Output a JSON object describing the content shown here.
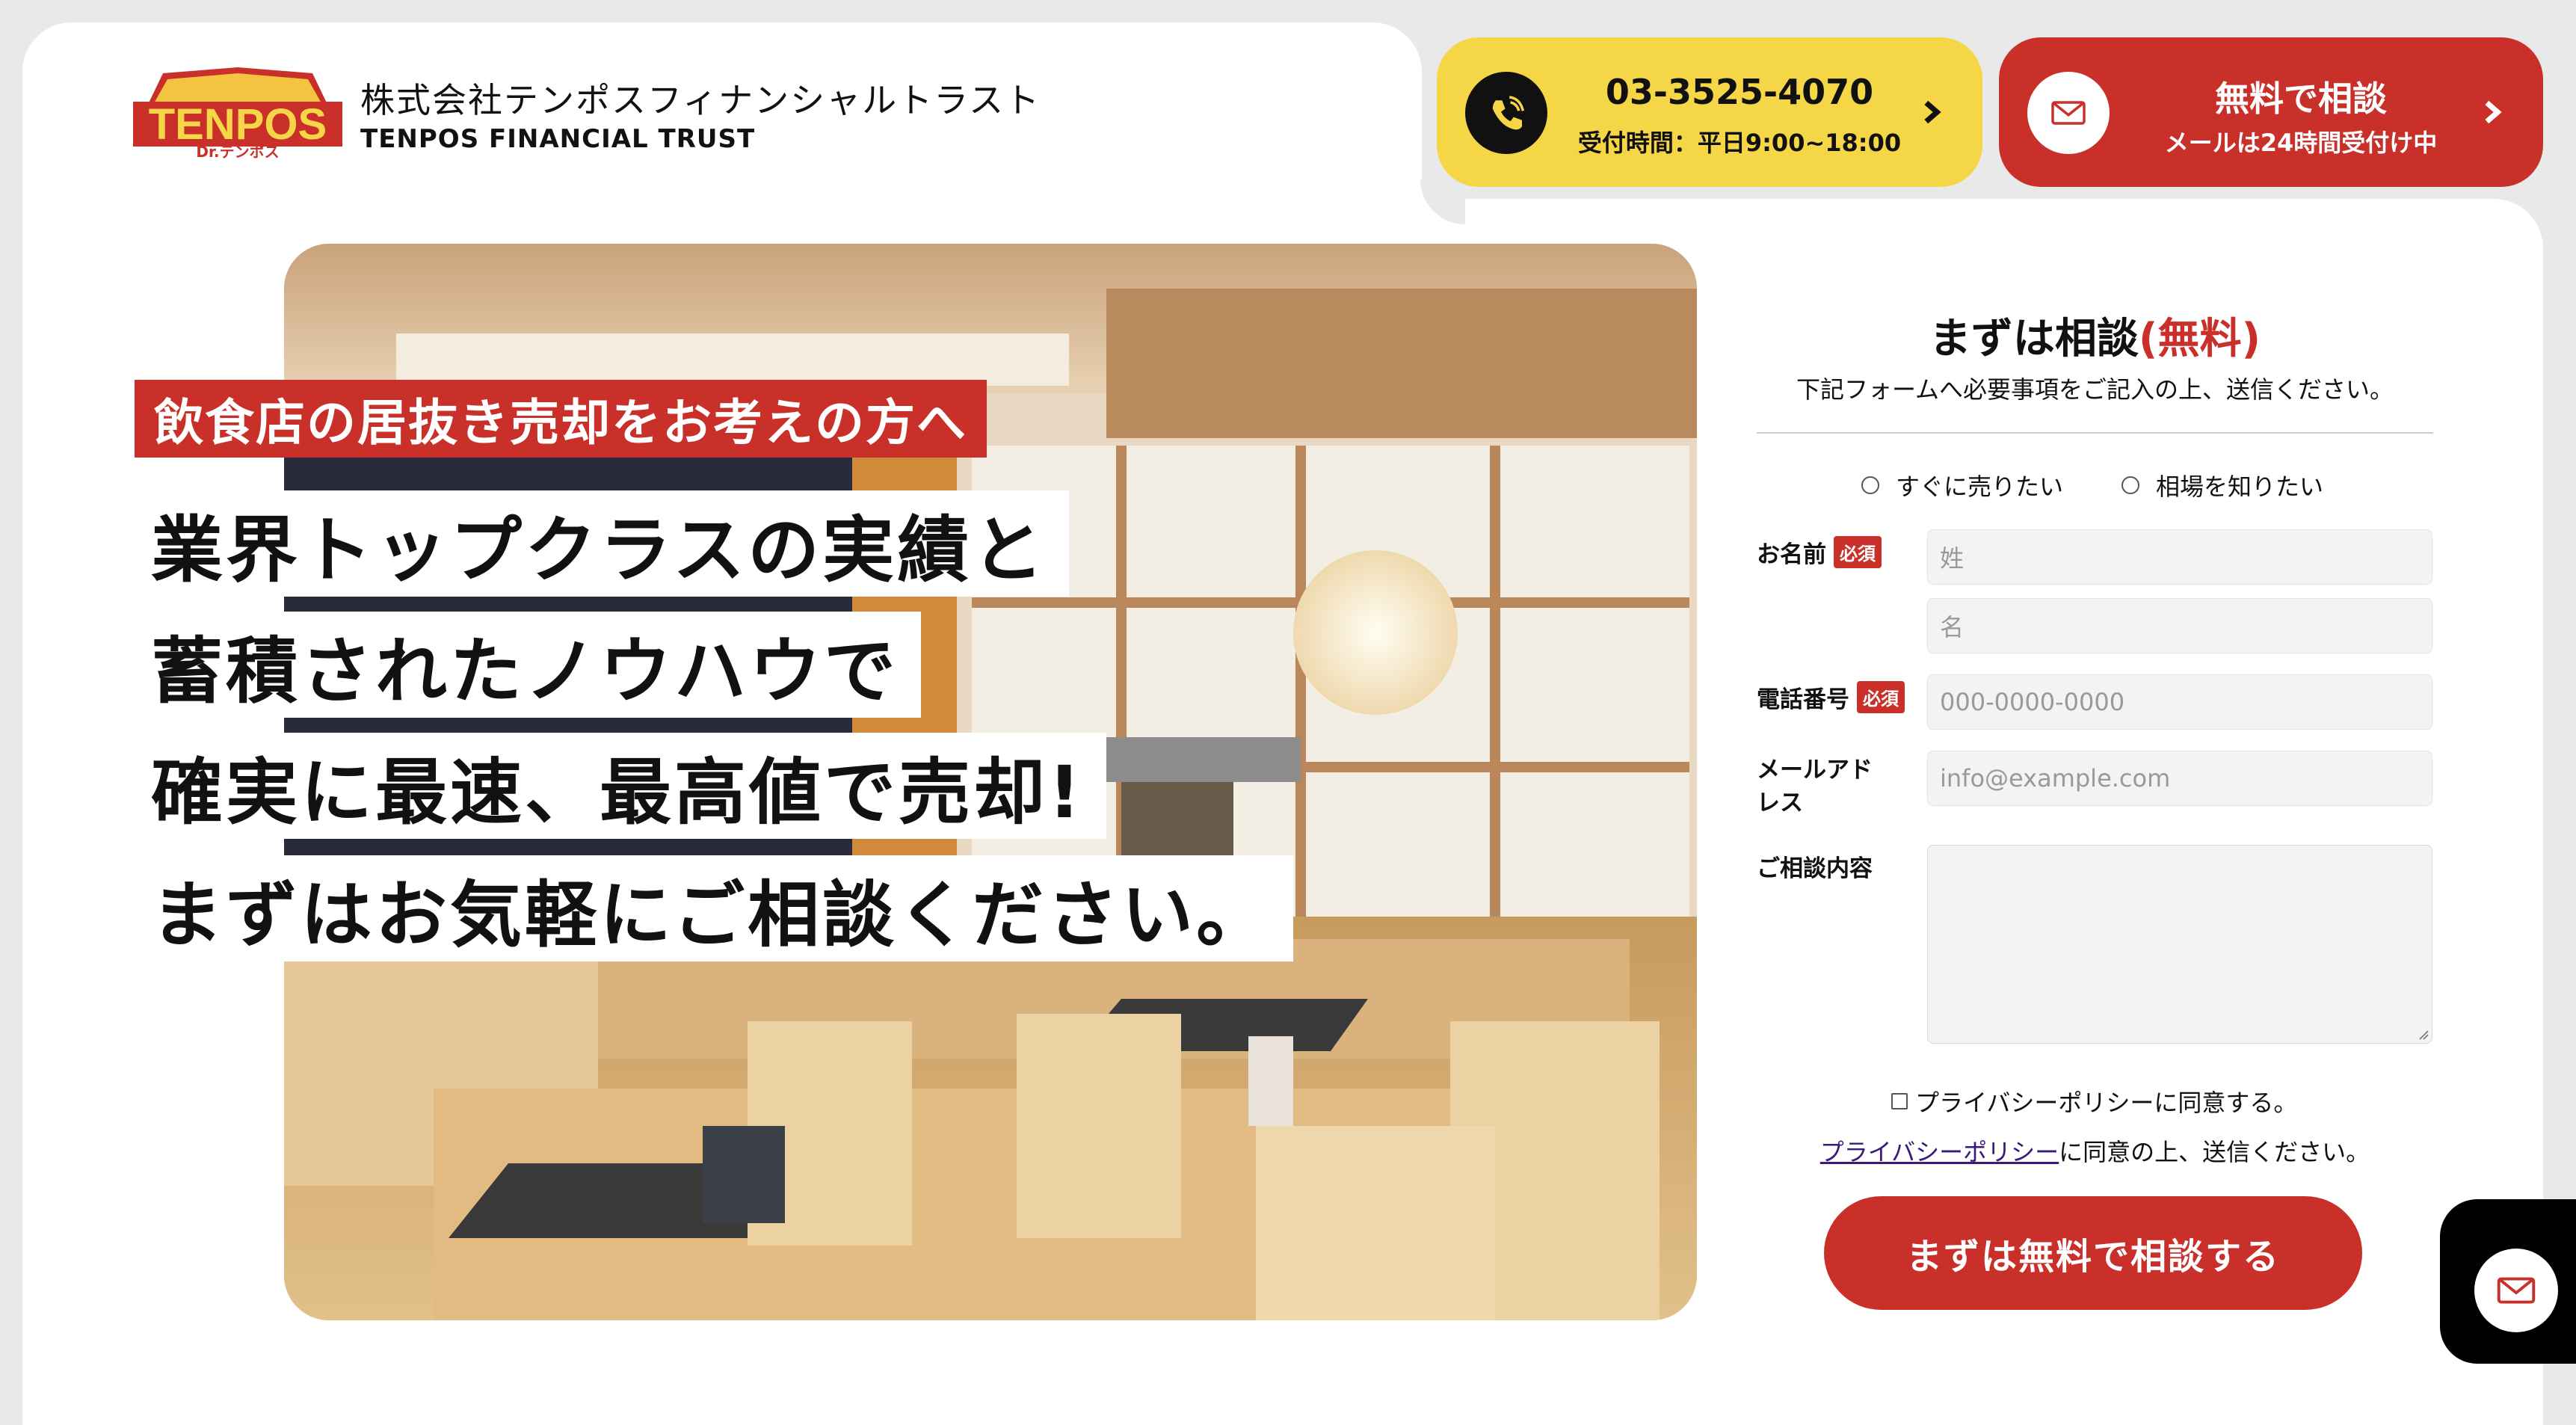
{
  "header": {
    "logo_text": "TENPOS",
    "logo_sub": "Dr.テンポス",
    "company_ja": "株式会社テンポスフィナンシャルトラスト",
    "company_en": "TENPOS FINANCIAL TRUST",
    "phone": {
      "number": "03-3525-4070",
      "hours": "受付時間：平日9:00~18:00"
    },
    "consult": {
      "label": "無料で相談",
      "sub": "メールは24時間受付け中"
    }
  },
  "hero": {
    "tag": "飲食店の居抜き売却をお考えの方へ",
    "lines": [
      "業界トップクラスの実績と",
      "蓄積されたノウハウで",
      "確実に最速、最高値で売却!",
      "まずはお気軽にご相談ください。"
    ]
  },
  "form": {
    "title": "まずは相談",
    "title_accent": "(無料)",
    "subtitle": "下記フォームへ必要事項をご記入の上、送信ください。",
    "radio_1": "すぐに売りたい",
    "radio_2": "相場を知りたい",
    "name_label": "お名前",
    "required": "必須",
    "last_name_placeholder": "姓",
    "first_name_placeholder": "名",
    "phone_label": "電話番号",
    "phone_placeholder": "000-0000-0000",
    "email_label": "メールアドレス",
    "email_placeholder": "info@example.com",
    "message_label": "ご相談内容",
    "agree_label": "プライバシーポリシーに同意する。",
    "policy_link": "プライバシーポリシー",
    "policy_rest": "に同意の上、送信ください。",
    "submit": "まずは無料で相談する"
  },
  "colors": {
    "accent_red": "#c9302a",
    "accent_yellow": "#f5d646"
  }
}
